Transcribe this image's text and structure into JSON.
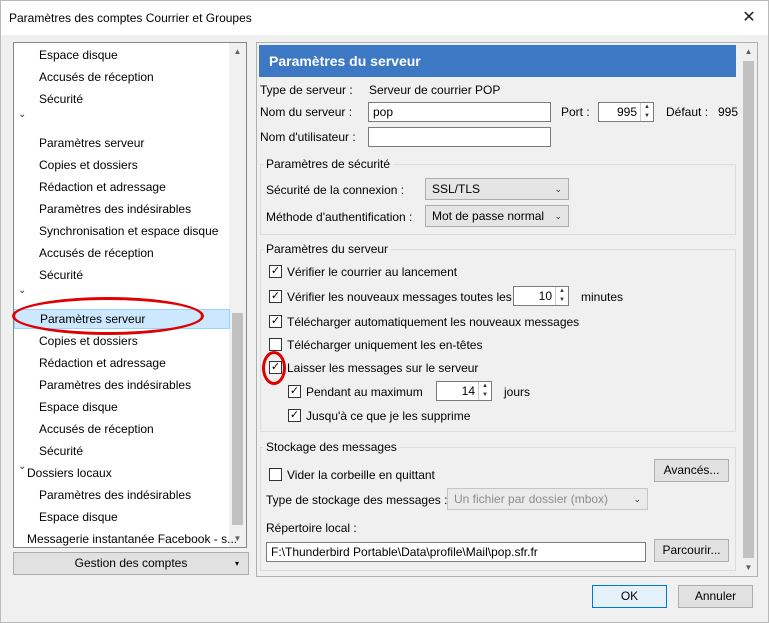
{
  "window": {
    "title": "Paramètres des comptes Courrier et Groupes",
    "close_glyph": "✕"
  },
  "tree": {
    "items": [
      {
        "label": "Espace disque",
        "indent": 2
      },
      {
        "label": "Accusés de réception",
        "indent": 2
      },
      {
        "label": "Sécurité",
        "indent": 2
      },
      {
        "label": "",
        "indent": 1,
        "twisty": "⌄"
      },
      {
        "label": "Paramètres serveur",
        "indent": 2
      },
      {
        "label": "Copies et dossiers",
        "indent": 2
      },
      {
        "label": "Rédaction et adressage",
        "indent": 2
      },
      {
        "label": "Paramètres des indésirables",
        "indent": 2
      },
      {
        "label": "Synchronisation et espace disque",
        "indent": 2
      },
      {
        "label": "Accusés de réception",
        "indent": 2
      },
      {
        "label": "Sécurité",
        "indent": 2
      },
      {
        "label": "",
        "indent": 1,
        "twisty": "⌄"
      },
      {
        "label": "Paramètres serveur",
        "indent": 2,
        "selected": true
      },
      {
        "label": "Copies et dossiers",
        "indent": 2
      },
      {
        "label": "Rédaction et adressage",
        "indent": 2
      },
      {
        "label": "Paramètres des indésirables",
        "indent": 2
      },
      {
        "label": "Espace disque",
        "indent": 2
      },
      {
        "label": "Accusés de réception",
        "indent": 2
      },
      {
        "label": "Sécurité",
        "indent": 2
      },
      {
        "label": "Dossiers locaux",
        "indent": 1,
        "twisty": "⌄"
      },
      {
        "label": "Paramètres des indésirables",
        "indent": 2
      },
      {
        "label": "Espace disque",
        "indent": 2
      },
      {
        "label": "Messagerie instantanée Facebook - s...",
        "indent": 1
      }
    ],
    "accounts_button": "Gestion des comptes"
  },
  "panel": {
    "header": "Paramètres du serveur",
    "server_type_label": "Type de serveur :",
    "server_type_value": "Serveur de courrier POP",
    "server_name_label": "Nom du serveur :",
    "server_name_value": "pop",
    "port_label": "Port :",
    "port_value": "995",
    "default_label": "Défaut :",
    "default_value": "995",
    "username_label": "Nom d'utilisateur :",
    "username_value": "",
    "security": {
      "title": "Paramètres de sécurité",
      "connection_label": "Sécurité de la connexion :",
      "connection_value": "SSL/TLS",
      "auth_label": "Méthode d'authentification :",
      "auth_value": "Mot de passe normal"
    },
    "server_settings": {
      "title": "Paramètres du serveur",
      "check_on_start": "Vérifier le courrier au lancement",
      "check_every": "Vérifier les nouveaux messages toutes les",
      "check_every_value": "10",
      "minutes": "minutes",
      "auto_download": "Télécharger automatiquement les nouveaux messages",
      "headers_only": "Télécharger uniquement les en-têtes",
      "leave_on_server": "Laisser les messages sur le serveur",
      "max_days": "Pendant au maximum",
      "max_days_value": "14",
      "days": "jours",
      "until_delete": "Jusqu'à ce que je les supprime"
    },
    "storage": {
      "title": "Stockage des messages",
      "empty_trash": "Vider la corbeille en quittant",
      "advanced_button": "Avancés...",
      "store_type_label": "Type de stockage des messages :",
      "store_type_value": "Un fichier par dossier (mbox)",
      "local_dir_label": "Répertoire local :",
      "local_dir_value": "F:\\Thunderbird Portable\\Data\\profile\\Mail\\pop.sfr.fr",
      "browse_button": "Parcourir..."
    }
  },
  "footer": {
    "ok_button": "OK",
    "cancel_button": "Annuler"
  },
  "checkmark_glyph": "✓",
  "colors": {
    "header": "#3c78c3",
    "annotation": "#e00000",
    "selection": "#cce8ff"
  }
}
